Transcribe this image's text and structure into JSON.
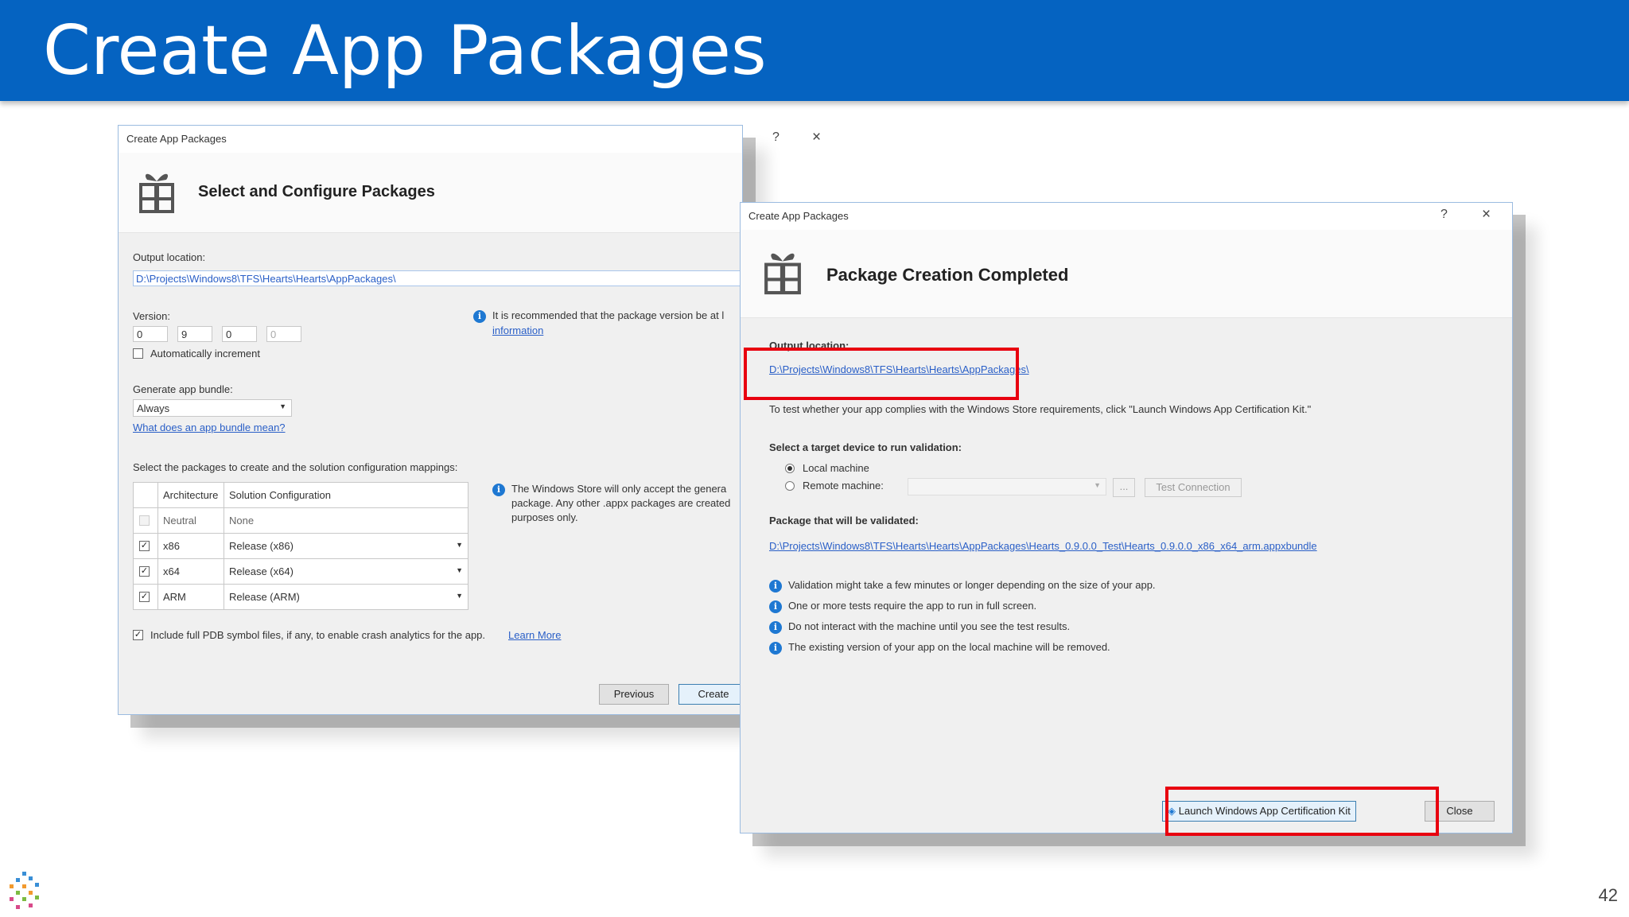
{
  "slide": {
    "title": "Create App Packages",
    "page_number": "42"
  },
  "dialog1": {
    "caption": "Create App Packages",
    "help_glyph": "?",
    "close_glyph": "×",
    "heading": "Select and Configure Packages",
    "output_label": "Output location:",
    "output_value": "D:\\Projects\\Windows8\\TFS\\Hearts\\Hearts\\AppPackages\\",
    "version_label": "Version:",
    "version_parts": [
      "0",
      "9",
      "0",
      "0"
    ],
    "version_note": "It is recommended that the package version be at l",
    "version_note_link": "information",
    "auto_increment_label": "Automatically increment",
    "bundle_label": "Generate app bundle:",
    "bundle_value": "Always",
    "bundle_link": "What does an app bundle mean?",
    "packages_label": "Select the packages to create and the solution configuration mappings:",
    "table_headers": [
      "Architecture",
      "Solution Configuration"
    ],
    "table_rows": [
      {
        "checked": false,
        "arch": "Neutral",
        "config": "None"
      },
      {
        "checked": true,
        "arch": "x86",
        "config": "Release (x86)"
      },
      {
        "checked": true,
        "arch": "x64",
        "config": "Release (x64)"
      },
      {
        "checked": true,
        "arch": "ARM",
        "config": "Release (ARM)"
      }
    ],
    "store_note_lines": [
      "The Windows Store will only accept the genera",
      "package. Any other .appx packages are created",
      "purposes only."
    ],
    "pdb_label": "Include full PDB symbol files, if any, to enable crash analytics for the app.",
    "pdb_link": "Learn More",
    "previous_label": "Previous",
    "create_label": "Create"
  },
  "dialog2": {
    "caption": "Create App Packages",
    "help_glyph": "?",
    "close_glyph": "×",
    "heading": "Package Creation Completed",
    "output_label": "Output location:",
    "output_link": "D:\\Projects\\Windows8\\TFS\\Hearts\\Hearts\\AppPackages\\",
    "test_instructions": "To test whether your app complies with the Windows Store requirements, click \"Launch Windows App Certification Kit.\"",
    "target_label": "Select a target device to run validation:",
    "local_label": "Local machine",
    "remote_label": "Remote machine:",
    "browse_label": "...",
    "test_connection_label": "Test Connection",
    "package_label": "Package that will be validated:",
    "package_link": "D:\\Projects\\Windows8\\TFS\\Hearts\\Hearts\\AppPackages\\Hearts_0.9.0.0_Test\\Hearts_0.9.0.0_x86_x64_arm.appxbundle",
    "notes": [
      "Validation might take a few minutes or longer depending on the size of your app.",
      "One or more tests require the app to run in full screen.",
      "Do not interact with the machine until you see the test results.",
      "The existing version of your app on the local machine will be removed."
    ],
    "launch_label": "Launch Windows App Certification Kit",
    "close_label": "Close"
  },
  "colors": {
    "title_bar": "#0563c1",
    "highlight": "#e8000f",
    "link": "#2a5fc7",
    "info_icon": "#1e78d2"
  }
}
